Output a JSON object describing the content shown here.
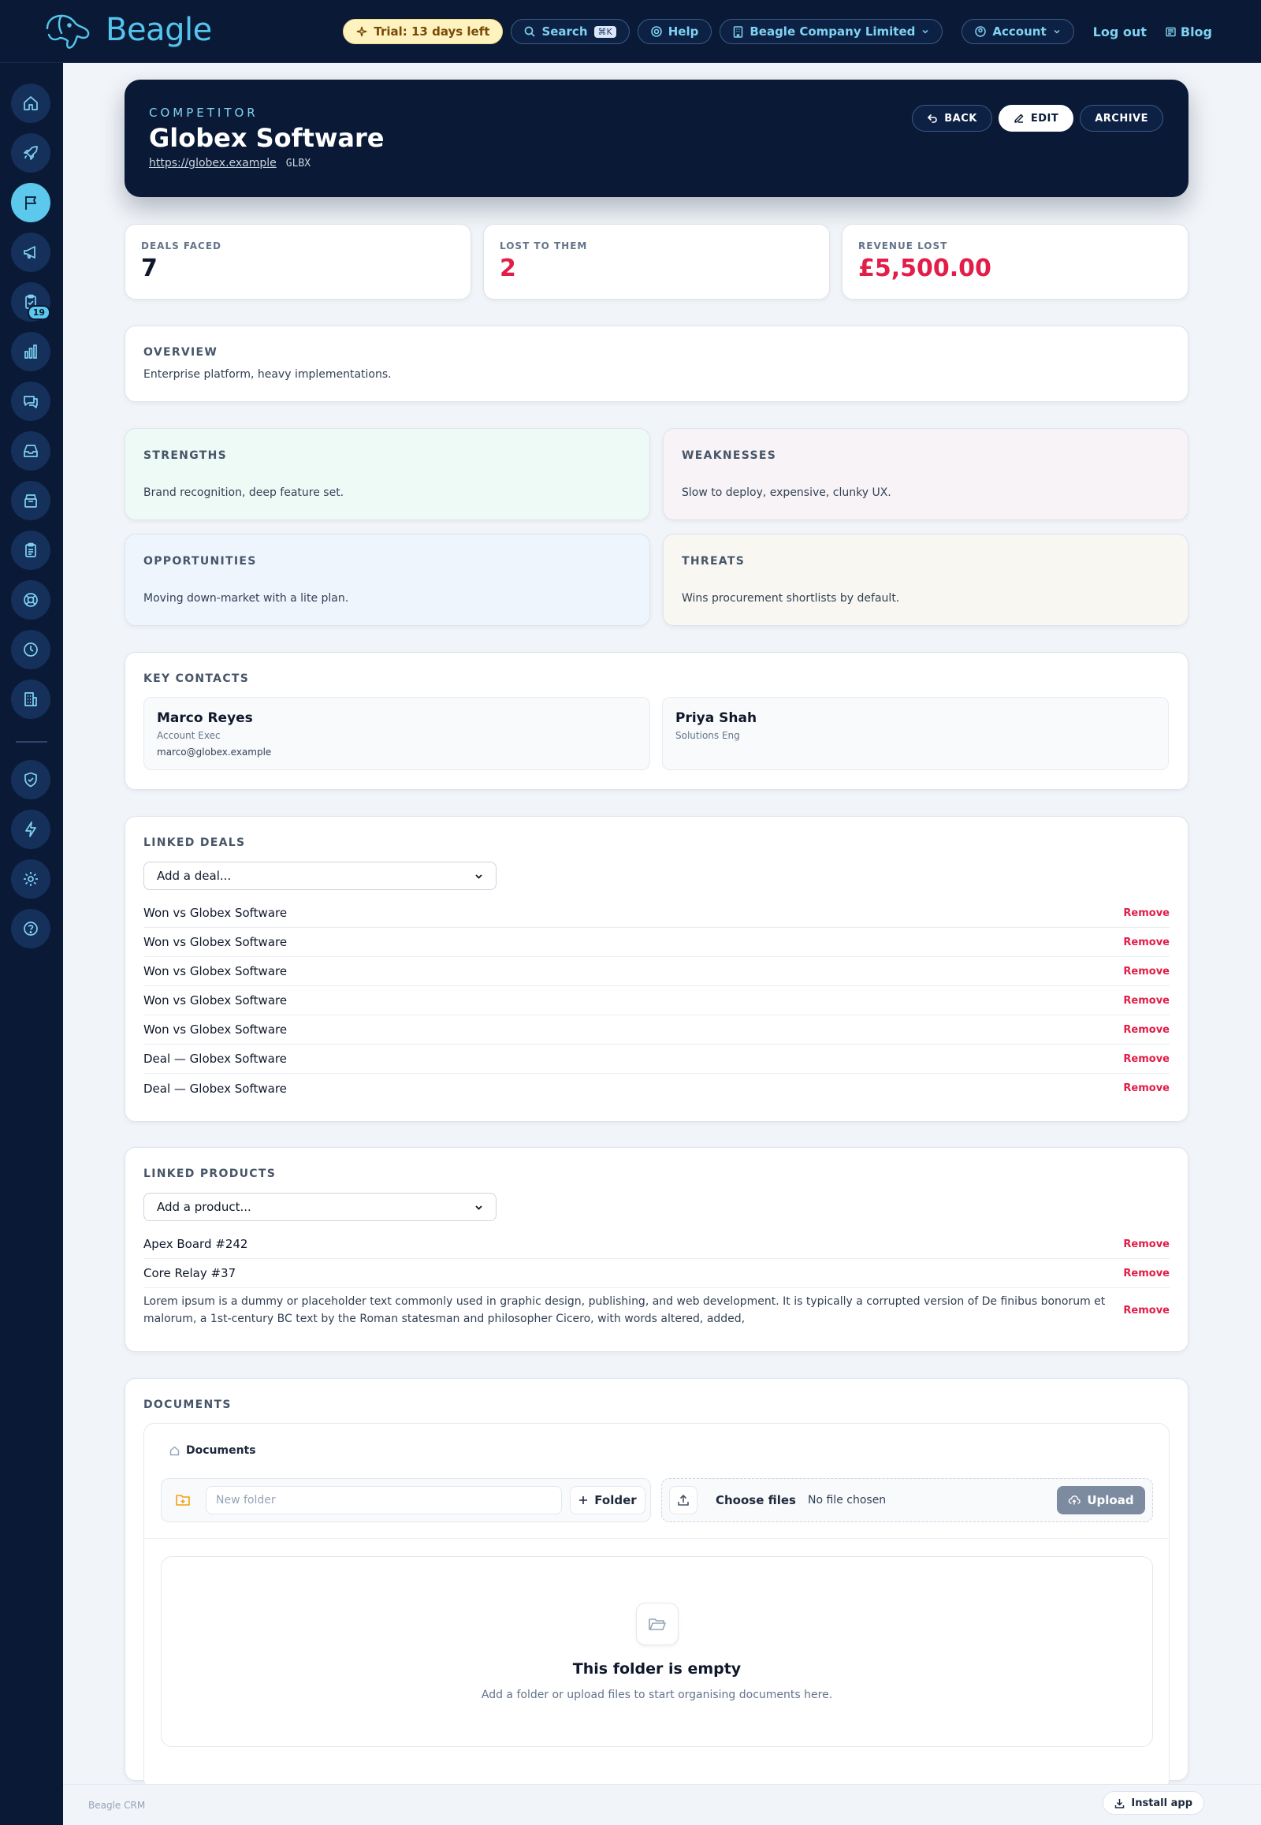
{
  "topbar": {
    "brand": "Beagle",
    "trial": "Trial: 13 days left",
    "search": "Search",
    "search_kbd": "⌘K",
    "help": "Help",
    "company": "Beagle Company Limited",
    "account": "Account",
    "logout": "Log out",
    "blog": "Blog"
  },
  "sidebar": {
    "tasks_badge": "19"
  },
  "hero": {
    "kicker": "COMPETITOR",
    "title": "Globex Software",
    "website": "https://globex.example",
    "ticker": "GLBX",
    "back": "BACK",
    "edit": "EDIT",
    "archive": "ARCHIVE"
  },
  "stats": [
    {
      "label": "DEALS FACED",
      "value": "7",
      "color": "#0f172a"
    },
    {
      "label": "LOST TO THEM",
      "value": "2",
      "color": "#e11d48"
    },
    {
      "label": "REVENUE LOST",
      "value": "£5,500.00",
      "color": "#e11d48"
    }
  ],
  "overview": {
    "title": "OVERVIEW",
    "text": "Enterprise platform, heavy implementations."
  },
  "swot": {
    "strengths": {
      "title": "STRENGTHS",
      "text": "Brand recognition, deep feature set.",
      "bg": "#eefaf5"
    },
    "weaknesses": {
      "title": "WEAKNESSES",
      "text": "Slow to deploy, expensive, clunky UX.",
      "bg": "#f7f3f6"
    },
    "opportunities": {
      "title": "OPPORTUNITIES",
      "text": "Moving down-market with a lite plan.",
      "bg": "#eef5fc"
    },
    "threats": {
      "title": "THREATS",
      "text": "Wins procurement shortlists by default.",
      "bg": "#f8f7f1"
    }
  },
  "contacts": {
    "title": "KEY CONTACTS",
    "items": [
      {
        "name": "Marco Reyes",
        "role": "Account Exec",
        "email": "marco@globex.example"
      },
      {
        "name": "Priya Shah",
        "role": "Solutions Eng",
        "email": ""
      }
    ]
  },
  "linked_deals": {
    "title": "LINKED DEALS",
    "select_placeholder": "Add a deal...",
    "remove_label": "Remove",
    "items": [
      "Won vs Globex Software",
      "Won vs Globex Software",
      "Won vs Globex Software",
      "Won vs Globex Software",
      "Won vs Globex Software",
      "Deal — Globex Software",
      "Deal — Globex Software"
    ]
  },
  "linked_products": {
    "title": "LINKED PRODUCTS",
    "select_placeholder": "Add a product...",
    "remove_label": "Remove",
    "items": [
      "Apex Board #242",
      "Core Relay #37",
      "Lorem ipsum is a dummy or placeholder text commonly used in graphic design, publishing, and web development. It is typically a corrupted version of De finibus bonorum et malorum, a 1st-century BC text by the Roman statesman and philosopher Cicero, with words altered, added,"
    ]
  },
  "documents": {
    "title": "DOCUMENTS",
    "breadcrumb": "Documents",
    "new_folder_placeholder": "New folder",
    "folder_button": "Folder",
    "choose_files": "Choose files",
    "no_file": "No file chosen",
    "upload": "Upload",
    "empty_title": "This folder is empty",
    "empty_text": "Add a folder or upload files to start organising documents here."
  },
  "footer": {
    "brand": "Beagle CRM",
    "install": "Install app"
  }
}
